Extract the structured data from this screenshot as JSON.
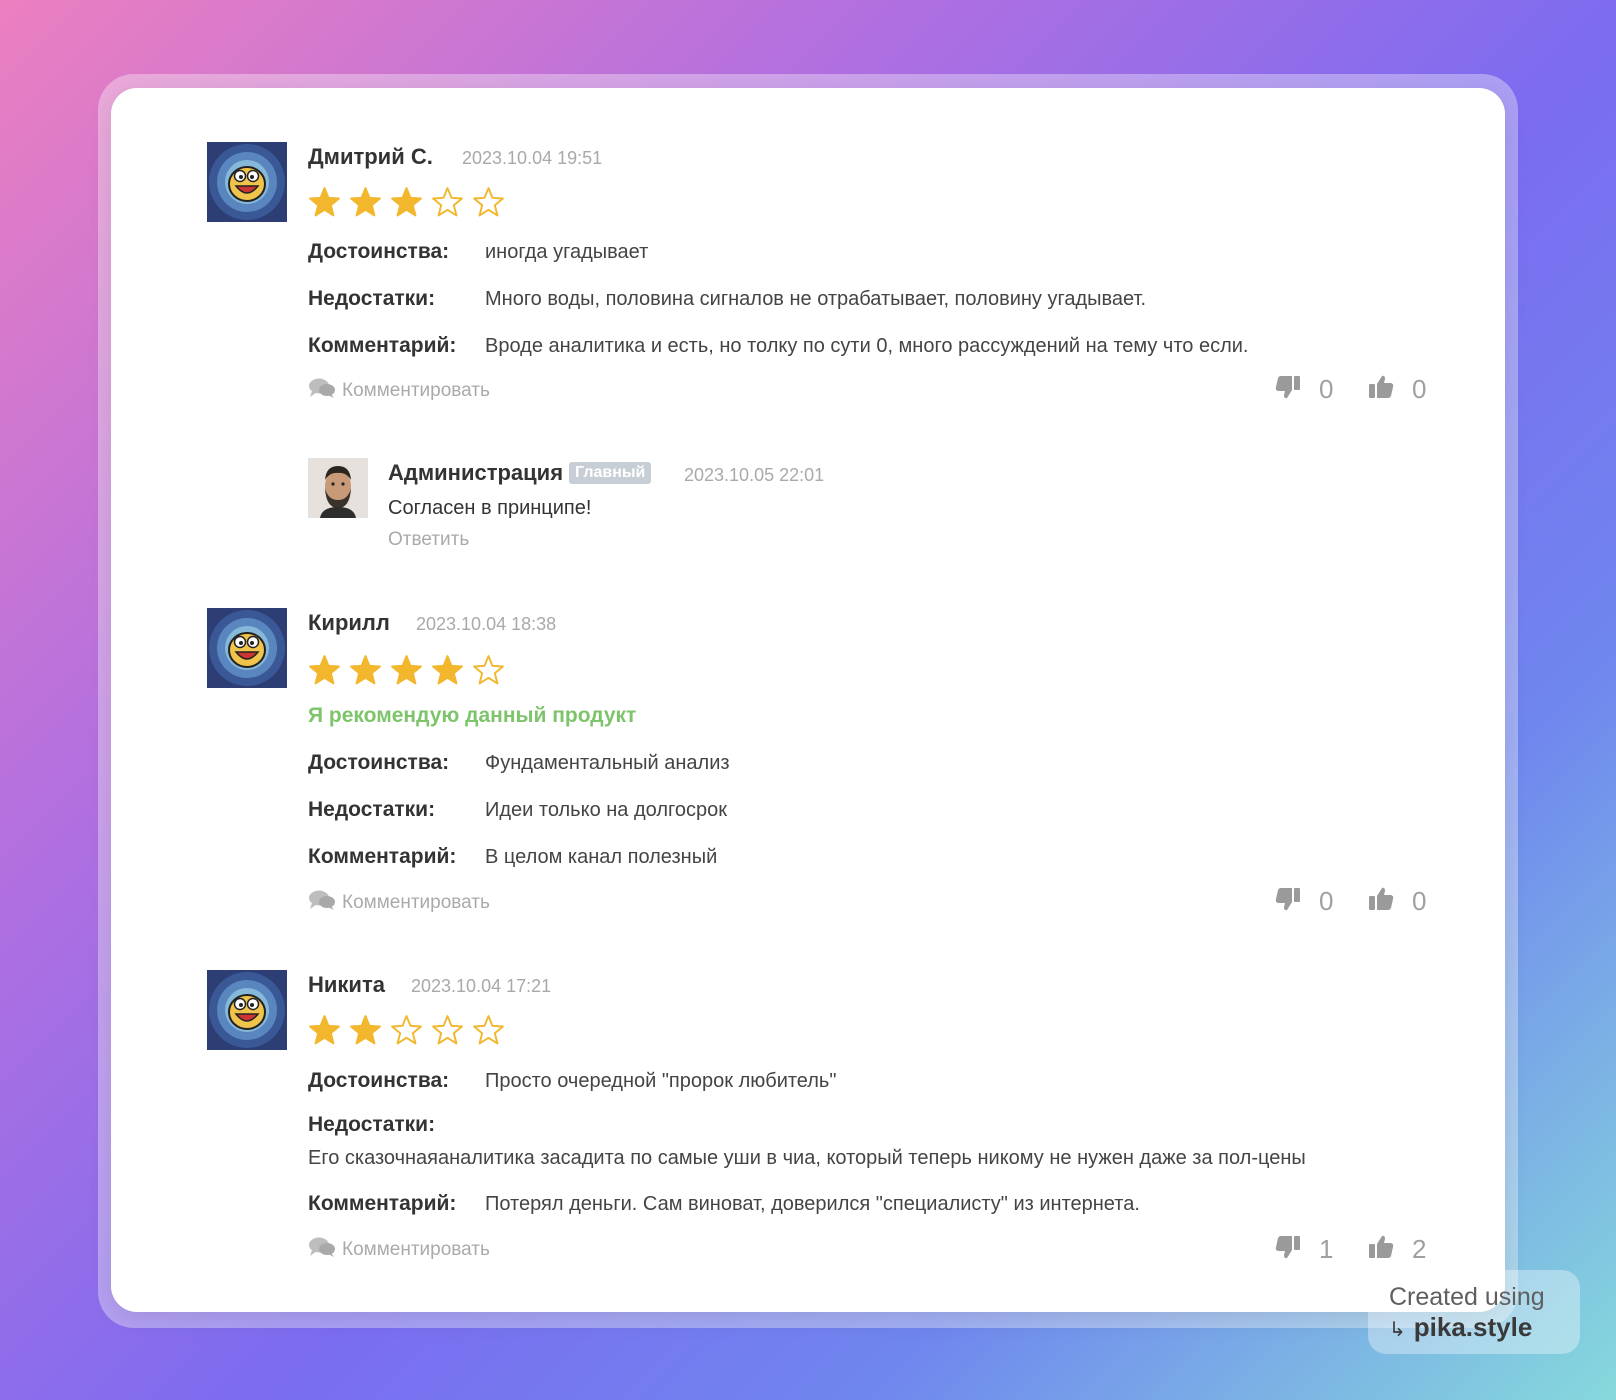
{
  "reviews": [
    {
      "author": "Дмитрий С.",
      "date": "2023.10.04 19:51",
      "rating": 3,
      "recommend": "",
      "pros_label": "Достоинства:",
      "pros": "иногда угадывает",
      "cons_label": "Недостатки:",
      "cons": "Много воды, половина сигналов не отрабатывает, половину угадывает.",
      "comment_label": "Комментарий:",
      "comment": "Вроде аналитика и есть, но толку по сути 0, много рассуждений на тему что если.",
      "comment_link": "Комментировать",
      "dislikes": "0",
      "likes": "0"
    },
    {
      "author": "Кирилл",
      "date": "2023.10.04 18:38",
      "rating": 4,
      "recommend": "Я рекомендую данный продукт",
      "pros_label": "Достоинства:",
      "pros": "Фундаментальный анализ",
      "cons_label": "Недостатки:",
      "cons": "Идеи только на долгосрок",
      "comment_label": "Комментарий:",
      "comment": "В целом канал полезный",
      "comment_link": "Комментировать",
      "dislikes": "0",
      "likes": "0"
    },
    {
      "author": "Никита",
      "date": "2023.10.04 17:21",
      "rating": 2,
      "recommend": "",
      "pros_label": "Достоинства:",
      "pros": "Просто очередной \"пророк любитель\"",
      "cons_label": "Недостатки:",
      "cons": "Его сказочнаяаналитика засадита по самые уши в чиа, который теперь никому не нужен даже за пол-цены",
      "comment_label": "Комментарий:",
      "comment": "Потерял деньги. Сам виноват, доверился \"специалисту\" из интернета.",
      "comment_link": "Комментировать",
      "dislikes": "1",
      "likes": "2"
    }
  ],
  "admin_reply": {
    "author": "Администрация",
    "badge": "Главный",
    "date": "2023.10.05 22:01",
    "text": "Согласен в принципе!",
    "reply_link": "Ответить"
  },
  "watermark": {
    "line1": "Created using",
    "line2": "pika.style"
  },
  "icons": {
    "avatar": "cartoon-face-avatar",
    "admin_avatar": "bearded-man-avatar",
    "comment": "speech-bubbles-icon",
    "dislike": "thumbs-down-icon",
    "like": "thumbs-up-icon",
    "star": "star-icon"
  },
  "colors": {
    "star": "#f2b72d",
    "recommend": "#7ec46a",
    "muted": "#aaaaaa"
  }
}
